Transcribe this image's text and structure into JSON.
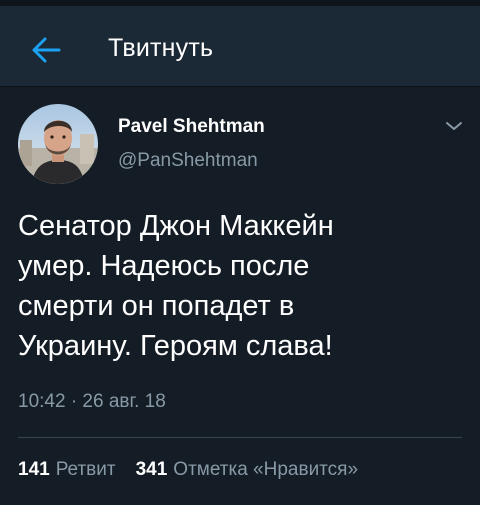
{
  "header": {
    "title": "Твитнуть",
    "back_icon": "arrow-left-icon"
  },
  "tweet": {
    "author": {
      "name": "Pavel Shehtman",
      "handle": "@PanShehtman",
      "avatar_icon": "user-avatar-photo"
    },
    "menu_icon": "chevron-down-icon",
    "text": "Сенатор Джон Маккейн\nумер.  Надеюсь после\nсмерти он попадет в\nУкраину. Героям слава!",
    "timestamp": "10:42 · 26 авг. 18",
    "stats": {
      "retweets_count": "141",
      "retweets_label": "Ретвит",
      "likes_count": "341",
      "likes_label": "Отметка «Нравится»"
    }
  },
  "colors": {
    "background": "#141d26",
    "header_background": "#1b2836",
    "accent": "#1da1f2",
    "secondary_text": "#8899a6",
    "divider": "#38444d"
  }
}
